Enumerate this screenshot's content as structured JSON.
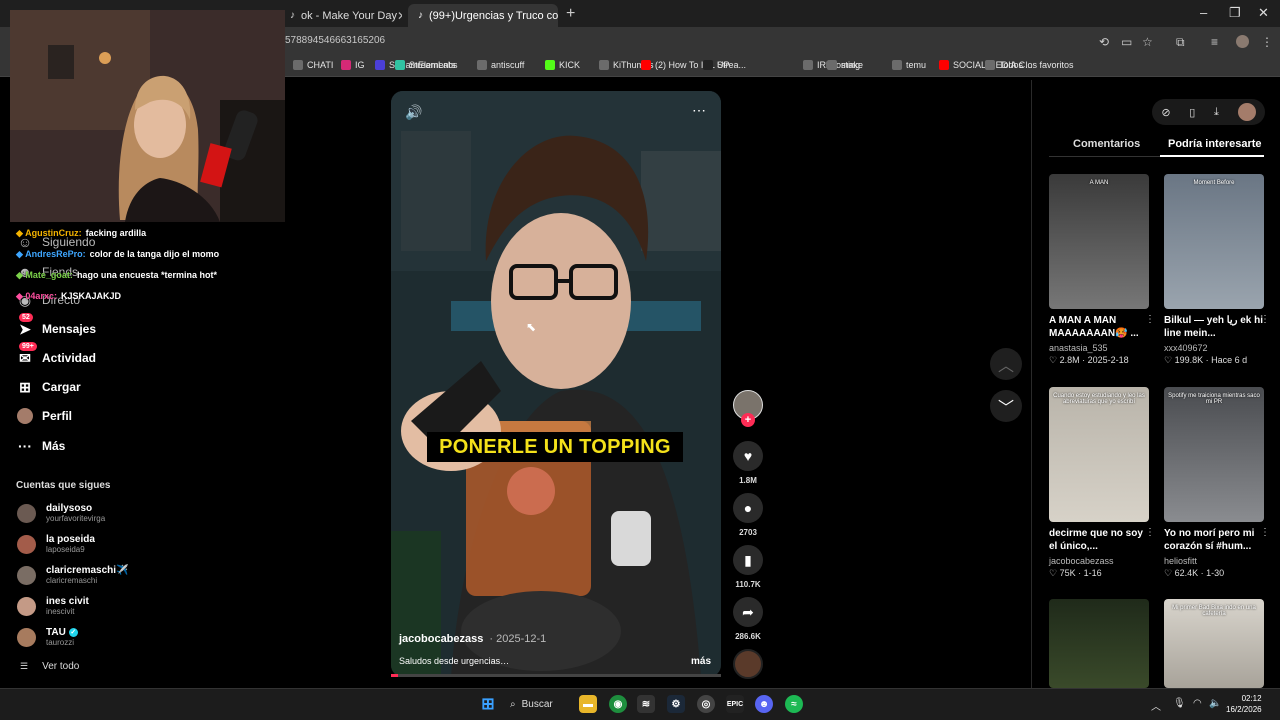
{
  "browser": {
    "tabs": [
      {
        "label": "ok - Make Your Day",
        "icon": "tiktok-icon"
      },
      {
        "label": "(99+)Urgencias y Truco con",
        "icon": "tiktok-icon"
      }
    ],
    "url_fragment": "578894546663165206",
    "bookmarks": [
      {
        "label": "CHATI",
        "color": "#6b6b6b"
      },
      {
        "label": "IG",
        "color": "#d62976"
      },
      {
        "label": "StreamElements",
        "color": "#4b3fd8"
      },
      {
        "label": "StreamLabs",
        "color": "#31c3a2"
      },
      {
        "label": "antiscuff",
        "color": "#6b6b6b"
      },
      {
        "label": "KICK",
        "color": "#53fc18"
      },
      {
        "label": "KiThumbs",
        "color": "#6b6b6b"
      },
      {
        "label": "(2) How To IRL Strea...",
        "color": "#ff0000"
      },
      {
        "label": "UP",
        "color": "#222222"
      },
      {
        "label": "IRLhosting",
        "color": "#6b6b6b"
      },
      {
        "label": "make",
        "color": "#6b6b6b"
      },
      {
        "label": "temu",
        "color": "#6b6b6b"
      },
      {
        "label": "SOCIAL MEDIA C...",
        "color": "#ff0000"
      },
      {
        "label": "Todos los favoritos",
        "color": "#6b6b6b"
      }
    ]
  },
  "sidebar": {
    "items": [
      {
        "label": "Siguiendo",
        "icon": "following-icon"
      },
      {
        "label": "Fiends",
        "icon": "friends-icon"
      },
      {
        "label": "Directo",
        "icon": "live-icon"
      },
      {
        "label": "Mensajes",
        "icon": "message-icon",
        "badge": "52"
      },
      {
        "label": "Actividad",
        "icon": "activity-icon",
        "badge": "99+"
      },
      {
        "label": "Cargar",
        "icon": "upload-icon"
      },
      {
        "label": "Perfil",
        "icon": "profile-icon"
      },
      {
        "label": "Más",
        "icon": "more-icon"
      }
    ],
    "following_title": "Cuentas que sigues",
    "accounts": [
      {
        "name": "dailysoso",
        "handle": "yourfavoritevirga",
        "color": "#6b5a52"
      },
      {
        "name": "la poseida",
        "handle": "laposeida9",
        "color": "#a35c4a"
      },
      {
        "name": "claricremaschi✈️",
        "handle": "claricremaschi",
        "color": "#7a6d64"
      },
      {
        "name": "ines civit",
        "handle": "inescivit",
        "color": "#c49a86"
      },
      {
        "name": "TAU",
        "handle": "taurozzi",
        "color": "#a77b5e",
        "verified": true
      }
    ],
    "see_all": "Ver todo"
  },
  "stream_chat": [
    {
      "user": "AgustinCruz:",
      "msg": "facking ardilla",
      "color": "#f5b400"
    },
    {
      "user": "AndresRePro:",
      "msg": "color de la tanga dijo el momo",
      "color": "#3ea6ff"
    },
    {
      "user": "Mate_goat:",
      "msg": "hago una encuesta *termina hot*",
      "color": "#7cd14a"
    },
    {
      "user": "04arxc:",
      "msg": "KJSKAJAKJD",
      "color": "#ff4fa0"
    }
  ],
  "video": {
    "overlay_text": "PONERLE UN TOPPING",
    "author": "jacobocabezass",
    "date": "· 2025-12-1",
    "caption": "Saludos desde urgencias…",
    "more": "más",
    "progress": 0.02,
    "likes": "1.8M",
    "comments": "2703",
    "saves": "110.7K",
    "shares": "286.6K"
  },
  "right_panel": {
    "tabs": [
      "Comentarios",
      "Podría interesarte"
    ],
    "active_tab": 1,
    "cards": [
      {
        "title": "A MAN A MAN MAAAAAAAN🥵 ...",
        "user": "anastasia_535",
        "meta": "♡ 2.8M · 2025-2-18",
        "thumb": [
          "#3a3a3a",
          "#777777"
        ],
        "thumb_label": "A MAN"
      },
      {
        "title": "Bilkul — yeh ریا ek hi line mein...",
        "user": "xxx409672",
        "meta": "♡ 199.8K · Hace 6 d",
        "thumb": [
          "#6a7684",
          "#9aa4ae"
        ],
        "thumb_label": "Moment Before"
      },
      {
        "title": "decirme que no soy el único,...",
        "user": "jacobocabezass",
        "meta": "♡ 75K · 1-16",
        "thumb": [
          "#b9b4aa",
          "#d7d2c8"
        ],
        "thumb_label": "Cuando estoy estudiando y leo las abreviaturas que yo escribí"
      },
      {
        "title": "Yo no morí pero mi corazón sí #hum...",
        "user": "heliosfitt",
        "meta": "♡ 62.4K · 1-30",
        "thumb": [
          "#4a4c50",
          "#8a8c90"
        ],
        "thumb_label": "Spotify me traiciona mientras saco mi PR"
      },
      {
        "title": "",
        "user": "",
        "meta": "",
        "thumb": [
          "#1f2a1a",
          "#3a4a2a"
        ],
        "thumb_label": ""
      },
      {
        "title": "",
        "user": "",
        "meta": "",
        "thumb": [
          "#d8d4cc",
          "#a8a39a"
        ],
        "thumb_label": "Mi primer Bad Bixa indo en una cafetería"
      }
    ]
  },
  "taskbar": {
    "search_label": "Buscar",
    "time": "02:12",
    "date": "16/2/2026"
  },
  "colors": {
    "accent": "#fe2c55",
    "caption_yellow": "#f4e11a"
  }
}
